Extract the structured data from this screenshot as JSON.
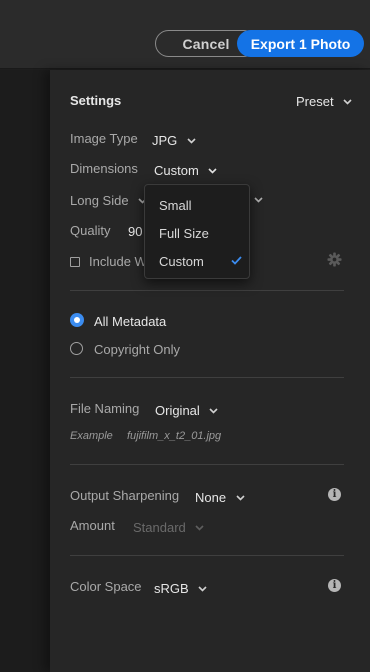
{
  "header": {
    "cancel_label": "Cancel",
    "export_label": "Export 1 Photo"
  },
  "settings": {
    "title": "Settings",
    "preset_label": "Preset",
    "image_type_label": "Image Type",
    "image_type_value": "JPG",
    "dimensions_label": "Dimensions",
    "dimensions_value": "Custom",
    "long_side_label": "Long Side",
    "quality_label": "Quality",
    "quality_value": "90",
    "include_label": "Include W"
  },
  "dimensions_menu": {
    "options": [
      "Small",
      "Full Size",
      "Custom"
    ],
    "selected": "Custom"
  },
  "metadata": {
    "all_label": "All Metadata",
    "copyright_label": "Copyright Only",
    "selected": "All Metadata"
  },
  "file_naming": {
    "label": "File Naming",
    "value": "Original",
    "example_label": "Example",
    "example_value": "fujifilm_x_t2_01.jpg"
  },
  "sharpening": {
    "label": "Output Sharpening",
    "value": "None",
    "amount_label": "Amount",
    "amount_value": "Standard"
  },
  "color_space": {
    "label": "Color Space",
    "value": "sRGB"
  },
  "colors": {
    "accent": "#1473e6",
    "radio_selected": "#3b8cf0",
    "panel_bg": "#262626"
  },
  "icons": [
    "chevron-down-icon",
    "checkmark-icon",
    "gear-icon",
    "info-icon"
  ]
}
